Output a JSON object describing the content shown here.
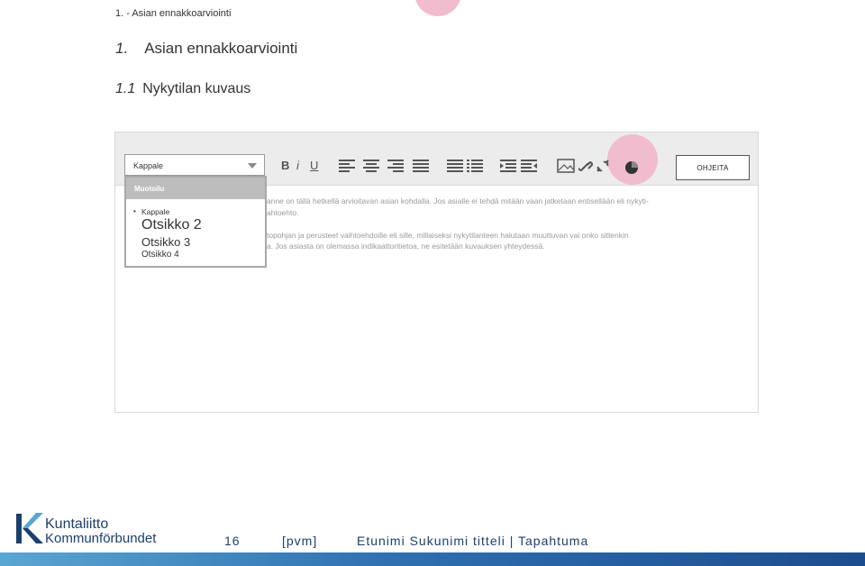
{
  "breadcrumb": "1. - Asian ennakkoarviointi",
  "heading1": {
    "number": "1.",
    "text": "Asian ennakkoarviointi"
  },
  "heading2": {
    "number": "1.1",
    "text": "Nykytilan kuvaus"
  },
  "editor": {
    "block_format": {
      "selected": "Kappale",
      "menu_header": "Muotoilu",
      "options": [
        "Kappale",
        "Otsikko 2",
        "Otsikko 3",
        "Otsikko 4"
      ]
    },
    "format_buttons": {
      "bold": "B",
      "italic": "i",
      "underline": "U"
    },
    "help_button": "OHJEITA",
    "body_lines": [
      "anne on tällä hetkellä arvioitavan asian kohdalla. Jos asialle ei tehdä mitään vaan jatketaan entisellään eli nykyti-",
      "ahtoehto.",
      "topohjan ja perusteet vaihtoehdoille eli sille, millaiseksi nykytilanteen halutaan muuttuvan vai onko sittenkin",
      "a. Jos asiasta on olemassa indikaattoritietoa, ne esitetään kuvauksen yhteydessä."
    ]
  },
  "footer": {
    "logo_line1": "Kuntaliitto",
    "logo_line2": "Kommunförbundet",
    "page_number": "16",
    "date": "[pvm]",
    "presenter": "Etunimi Sukunimi titteli | Tapahtuma"
  },
  "colors": {
    "highlight": "#f1bccd",
    "brand_dark": "#1b3f6e",
    "brand_light": "#5aa6d2"
  }
}
